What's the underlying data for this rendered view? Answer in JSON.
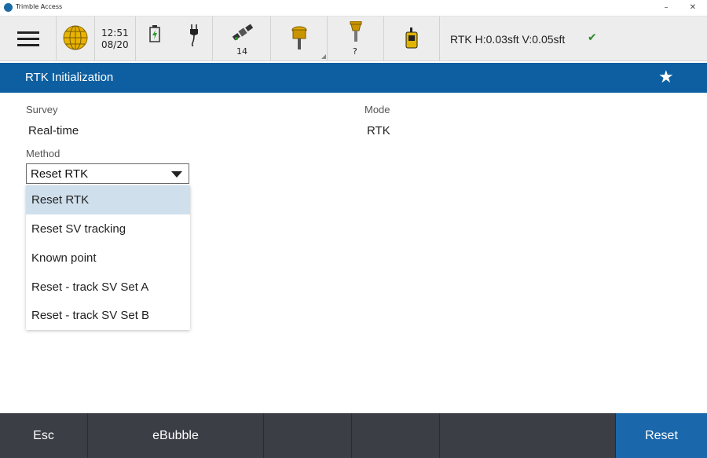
{
  "window": {
    "title": "Trimble Access",
    "min_label": "–",
    "close_label": "✕"
  },
  "statusbar": {
    "time": "12:51",
    "date": "08/20",
    "satellite_count": "14",
    "receiver_unknown": "?",
    "rtk_status": "RTK H:0.03sft V:0.05sft"
  },
  "header": {
    "title": "RTK Initialization",
    "favorite_icon": "star-icon"
  },
  "form": {
    "survey_label": "Survey",
    "survey_value": "Real-time",
    "mode_label": "Mode",
    "mode_value": "RTK",
    "method_label": "Method",
    "method_value": "Reset RTK",
    "method_options": [
      "Reset RTK",
      "Reset SV tracking",
      "Known point",
      "Reset - track SV Set A",
      "Reset - track SV Set B"
    ]
  },
  "footer": {
    "esc": "Esc",
    "ebubble": "eBubble",
    "reset": "Reset"
  },
  "colors": {
    "accent": "#0d5fa1",
    "footer": "#3b3e45",
    "primary_button": "#1a67ab",
    "selected_option": "#cfdfec"
  }
}
